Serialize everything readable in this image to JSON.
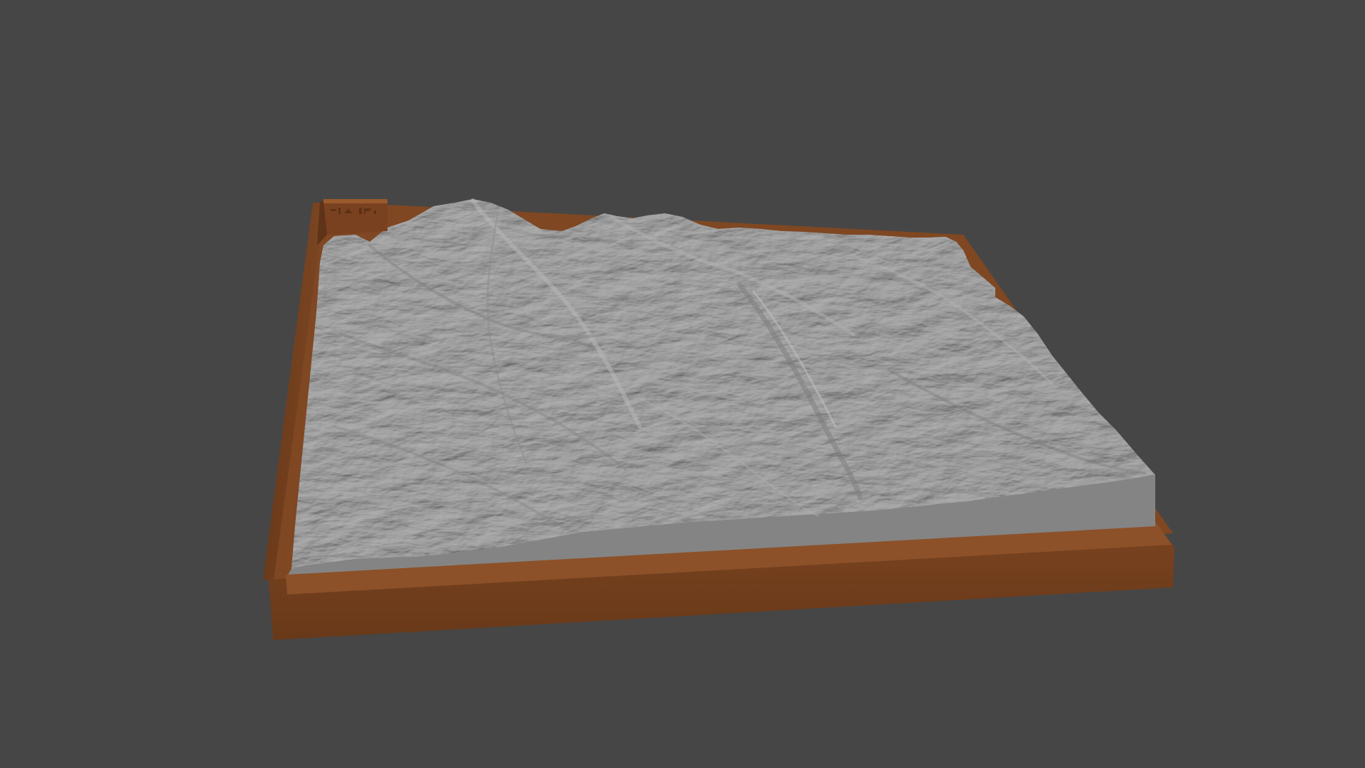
{
  "scene": {
    "background_color": "#464646",
    "object": "terrain-relief-model",
    "base_color": "#7a4420",
    "base_front_color": "#6f3d1c",
    "base_side_color": "#5a3116",
    "base_top_color": "#8a5128",
    "terrain_color": "#9c9c9c",
    "terrain_highlight_color": "#b8b8b8",
    "terrain_shadow_color": "#7e7e7e",
    "terrain_side_color": "#828282",
    "label_block_color": "#8b4e25",
    "label_block_icon": "engraved-logo-icon"
  }
}
